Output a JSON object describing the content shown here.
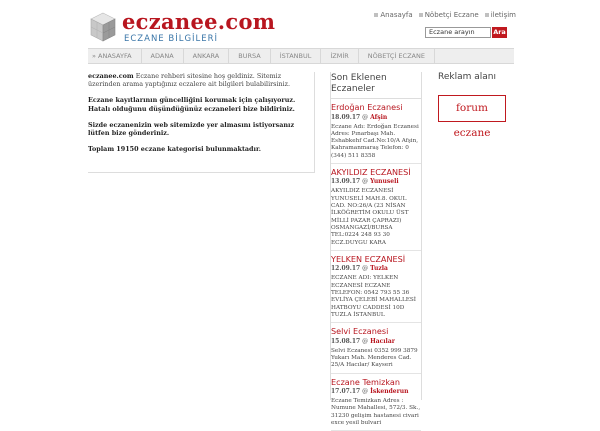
{
  "header": {
    "title": "eczanee.com",
    "subtitle": "ECZANE BİLGİLERİ",
    "top_links": [
      "Anasayfa",
      "Nöbetçi Eczane",
      "iletişim"
    ],
    "search_placeholder": "Eczane arayın",
    "search_button": "Ara"
  },
  "nav": {
    "items": [
      "» ANASAYFA",
      "ADANA",
      "ANKARA",
      "BURSA",
      "İSTANBUL",
      "İZMİR",
      "NÖBETÇİ ECZANE"
    ]
  },
  "main": {
    "p1_brand": "eczanee.com",
    "p1_text": " Eczane rehberi sitesine hoş geldiniz. Sitemiz üzerinden arama yaptığınız eczalere ait bilgileri bulabilirsiniz.",
    "p2": "Eczane kayıtlarının güncelliğini korumak için çalışıyoruz. Hatalı olduğunu düşündüğünüz eczaneleri bize bildiriniz.",
    "p3": "Sizde eczanenizin web sitemizde yer almasını istiyorsanız lütfen bize gönderiniz.",
    "p4": "Toplam 19150 eczane kategorisi bulunmaktadır."
  },
  "recent": {
    "heading": "Son Eklenen Eczaneler",
    "posts": [
      {
        "title": "Erdoğan Eczanesi",
        "date": "18.09.17",
        "sep": " @ ",
        "category": "Afşin",
        "body": "Eczane Adı: Erdoğan Eczanesi Adres: Pınarbaşı Mah. Eshabkehf Cad.No:10/A Afşin, Kahramanmaraş Telefon: 0 (344) 511 8358"
      },
      {
        "title": "AKYILDIZ ECZANESİ",
        "date": "13.09.17",
        "sep": " @ ",
        "category": "Yunuseli",
        "body": "AKYILDIZ ECZANESİ YUNUSELİ MAH.8. OKUL CAD. NO:26/A (23 NİSAN İLKÖĞRETİM OKULU ÜST MİLLİ PAZAR ÇAPRAZI) OSMANGAZİ/BURSA TEL:0224 248 93 30 ECZ.DUYGU KARA"
      },
      {
        "title": "YELKEN ECZANESİ",
        "date": "12.09.17",
        "sep": " @ ",
        "category": "Tuzla",
        "body": "ECZANE ADI: YELKEN ECZANESİ ECZANE TELEFON: 0542 793 55 36 EVLİYA ÇELEBİ MAHALLESİ HATBOYU CADDESİ 10D TUZLA İSTANBUL"
      },
      {
        "title": "Selvi Eczanesi",
        "date": "15.08.17",
        "sep": " @ ",
        "category": "Hacılar",
        "body": "Selvi Eczanesi 0352 999 3879 Yukarı Mah. Menderes Cad. 25/A Hacılar/ Kayseri"
      },
      {
        "title": "Eczane Temizkan",
        "date": "17.07.17",
        "sep": " @ ",
        "category": "İskenderun",
        "body": "Eczane Temizkan Adres : Numune Mahallesi, 572/3. Sk., 31230 gelişim hastanesi civari exce yesil bulvari"
      }
    ]
  },
  "ads": {
    "heading": "Reklam alanı",
    "banner": "forum eczane"
  },
  "colors": {
    "brand_red": "#b8161f",
    "subtitle_blue": "#3a76a8"
  }
}
